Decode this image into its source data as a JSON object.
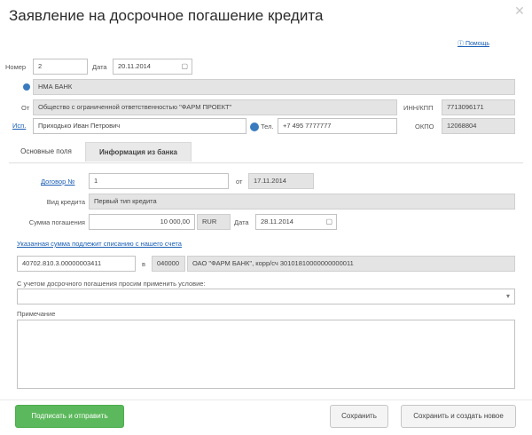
{
  "title": "Заявление на досрочное погашение кредита",
  "close_icon": "close-icon",
  "help": {
    "label": "Помощь"
  },
  "header": {
    "number_label": "Номер",
    "number_value": "2",
    "date_label": "Дата",
    "date_value": "20.11.2014",
    "bank_value": "НМА БАНК",
    "from_label": "От",
    "from_value": "Общество с ограниченной ответственностью \"ФАРМ ПРОЕКТ\"",
    "inn_label": "ИНН/КПП",
    "inn_value": "7713096171",
    "signer_label": "Исп.",
    "signer_value": "Приходько Иван Петрович",
    "phone_label": "Тел.",
    "phone_value": "+7 495 7777777",
    "okpo_label": "ОКПО",
    "okpo_value": "12068804"
  },
  "tabs": [
    {
      "label": "Основные поля"
    },
    {
      "label": "Информация из банка"
    }
  ],
  "main": {
    "contract_label": "Договор №",
    "contract_value": "1",
    "contract_date_label": "от",
    "contract_date_value": "17.11.2014",
    "credit_type_label": "Вид кредита",
    "credit_type_value": "Первый тип кредита",
    "sum_label": "Сумма погашения",
    "sum_value": "10 000,00",
    "currency_value": "RUR",
    "repay_date_label": "Дата",
    "repay_date_value": "28.11.2014",
    "account_link": "Указанная сумма подлежит списанию с нашего счета",
    "account_value": "40702.810.3.00000003411",
    "bank_in_label": "в",
    "bik_value": "040000",
    "bank_account_value": "ОАО \"ФАРМ БАНК\", корр/сч 30101810000000000011",
    "conditions_label": "С учетом досрочного погашения просим применить условие:",
    "conditions_value": "",
    "note_label": "Примечание",
    "note_value": ""
  },
  "buttons": {
    "sign_send": "Подписать и отправить",
    "save": "Сохранить",
    "save_new": "Сохранить и создать новое"
  },
  "colors": {
    "accent_green": "#5cb85c",
    "link_blue": "#1a5fb4",
    "readonly_gray": "#e4e4e4"
  }
}
